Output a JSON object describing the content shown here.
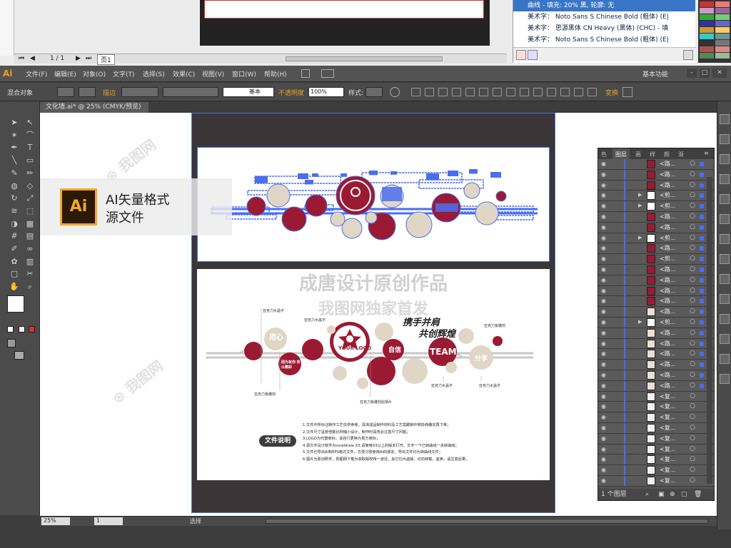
{
  "topapp": {
    "page_num": "1 / 1",
    "page_tab": "页1",
    "right_panel": [
      {
        "text": "曲线 - 填充: 20% 黑, 轮廓: 无",
        "selected": true
      },
      {
        "text": "美术字： Noto Sans S Chinese Bold (粗体) (E|",
        "selected": false
      },
      {
        "text": "美术字： 思源黑体 CN Heavy (黑体) (CHC) - 填",
        "selected": false
      },
      {
        "text": "美术字： Noto Sans S Chinese Bold (粗体) (E|",
        "selected": false
      }
    ]
  },
  "menubar": {
    "logo": "Ai",
    "items": [
      "文件(F)",
      "编辑(E)",
      "对象(O)",
      "文字(T)",
      "选择(S)",
      "效果(C)",
      "视图(V)",
      "窗口(W)",
      "帮助(H)"
    ],
    "workspace": "基本功能"
  },
  "controlbar": {
    "label": "混合对象",
    "stroke_label": "描边",
    "stroke_style": "基本",
    "opacity_label": "不透明度",
    "opacity_value": "100%",
    "style_label": "样式:",
    "transform_label": "变换"
  },
  "tab": {
    "title": "文化墙.ai* @ 25% (CMYK/预览)"
  },
  "badge": {
    "logo": "Ai",
    "line1": "AI矢量格式",
    "line2": "源文件"
  },
  "artwork": {
    "watermark_title": "成唐设计原创作品",
    "watermark_sub": "我图网独家首发",
    "logo_text": "YOUR LOGO",
    "team_text": "TEAM",
    "slogan1": "携手并肩",
    "slogan2": "共创辉煌",
    "c_label1": "用心",
    "c_label2": "自信",
    "c_label3": "分享",
    "c_label4": "因为有你 所以精彩",
    "acrylic_top1": "亚克力水晶字",
    "acrylic_top2": "亚克力水晶字",
    "acrylic_right": "亚克力板雕刻",
    "acrylic_left": "亚克力板雕刻",
    "acrylic_bottom": "亚克力板雕刻贴相片",
    "acrylic_team": "亚克力水晶字",
    "acrylic_share": "亚克力水晶字",
    "doc_title": "文件说明",
    "notes": [
      "1.文件中所标注制作工艺仅供参考，具体成品制作材料及工艺需跟制作商协商确定再下单；",
      "2.文件尺寸呈按倍数比例缩小设计，制作时请务必注意尺寸问题；",
      "3.LOGO为代替商标，请自行更换为贵方商标；",
      "4.源文件设计软件为coreldraw X3,请使用X3以上的版本打开。文字一个已转曲线一关转曲线；",
      "5.文件已导出AI和EPS格式文件，方便习惯使用AI的朋友，导出文件均为转曲线文件；",
      "6.图片为原创照件，购图网下载为获取版权特一途径，其它均为盗版，切勿转载，盗卖，请注意后果。"
    ]
  },
  "layers": {
    "tabs": [
      "色",
      "图层",
      "画",
      "样",
      "颜",
      "渐"
    ],
    "row_labels": [
      "<路...",
      "<路...",
      "<路...",
      "<剪...",
      "<剪...",
      "<路...",
      "<路...",
      "<剪...",
      "<路...",
      "<剪...",
      "<路...",
      "<路...",
      "<路...",
      "<路...",
      "<路...",
      "<剪...",
      "<路...",
      "<路...",
      "<路...",
      "<路...",
      "<路...",
      "<路...",
      "<复...",
      "<复...",
      "<复...",
      "<复...",
      "<复...",
      "<复...",
      "<复...",
      "<复...",
      "<复..."
    ],
    "footer": "1 个图层"
  },
  "status": {
    "zoom": "25%",
    "artboard": "1",
    "tool": "选择"
  },
  "colors": {
    "crimson": "#9b1a33",
    "beige": "#e0d6c5",
    "gray": "#b0b0b0",
    "select_blue": "#4a6ef0",
    "ai_orange": "#f6a623"
  }
}
